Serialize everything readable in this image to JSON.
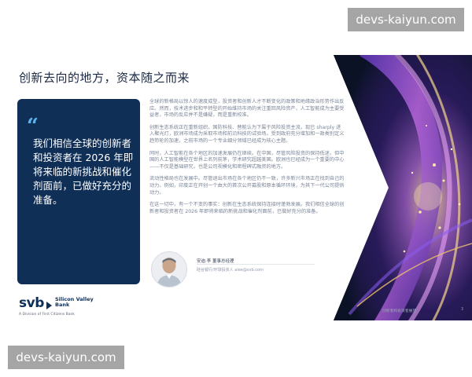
{
  "watermark": {
    "top": "devs-kaiyun.com",
    "bottom": "devs-kaiyun.com"
  },
  "slide": {
    "title": "创新去向的地方，资本随之而来",
    "quote_icon": "double-quote-icon",
    "quote": "我们相信全球的创新者和投资者在 2026 年即将来临的新挑战和催化剂面前，已做好充分的准备。",
    "paragraphs": [
      "全球的新格局以惊人的速度成型，投资者和创新人才不断变化的政策和地缘政治形势作出反应。然而，技术进步和和平转型的开始维持市场的关注重回风险资产，人工智能成为主要受益者，市场的反应并不是嫌疑，而是重新校准。",
      "创新生态系统正在重新组织。国防科技、替能认为下属于风险投资主流，现已 sharply 进入聚光灯，欧洲市场成为采取市场和前沿科技的试验场。受到政府充分增加和一政类别定义趋势轮的加速，之前市场的一个专业细分领域已经成为核心主题。",
      "同时，人工智能在各个地区的加速发展仍在继续。在中国，尽管风险投资的保持低迷，但中国的人工智能模型在世界上名列前茅，学术研究超越美国。欧洲也已经成为一个重要的中心——不仅是基础研究，也是公司视模化和密程碑式融资的地方。",
      "流动性格局也在发展中。尽管退出市场在各个地区仍不一致，许多新兴市场正在找到自己的动力。例如，印度正在开创一个由大的首次公开募股和原本循环环境，为其下一代公司提供动力。",
      "在这一切中，有一个不变的事实：创新在生态系统保持连接时蓬勃发展。我们相信全球的创新者和投资者在 2026 年即将来临的新挑战和催化剂面前，已做好充分的准备。"
    ],
    "author": {
      "name": "安迪·李 董事总经理",
      "contact": "硅谷银行/环球投资人 alee@svb.com"
    },
    "brand": {
      "logo_text": "svb",
      "name_line1": "Silicon Valley",
      "name_line2": "Bank",
      "sub": "A Division of First Citizens Bank"
    },
    "footer": "创新者和投资者展望",
    "page_number": "3"
  },
  "colors": {
    "navy": "#0f2f57",
    "quote_accent": "#5fb4ee",
    "title": "#1c2a44",
    "body": "#7a8597",
    "visual_purple": "#7a3cc4",
    "visual_dark": "#0b1226"
  }
}
